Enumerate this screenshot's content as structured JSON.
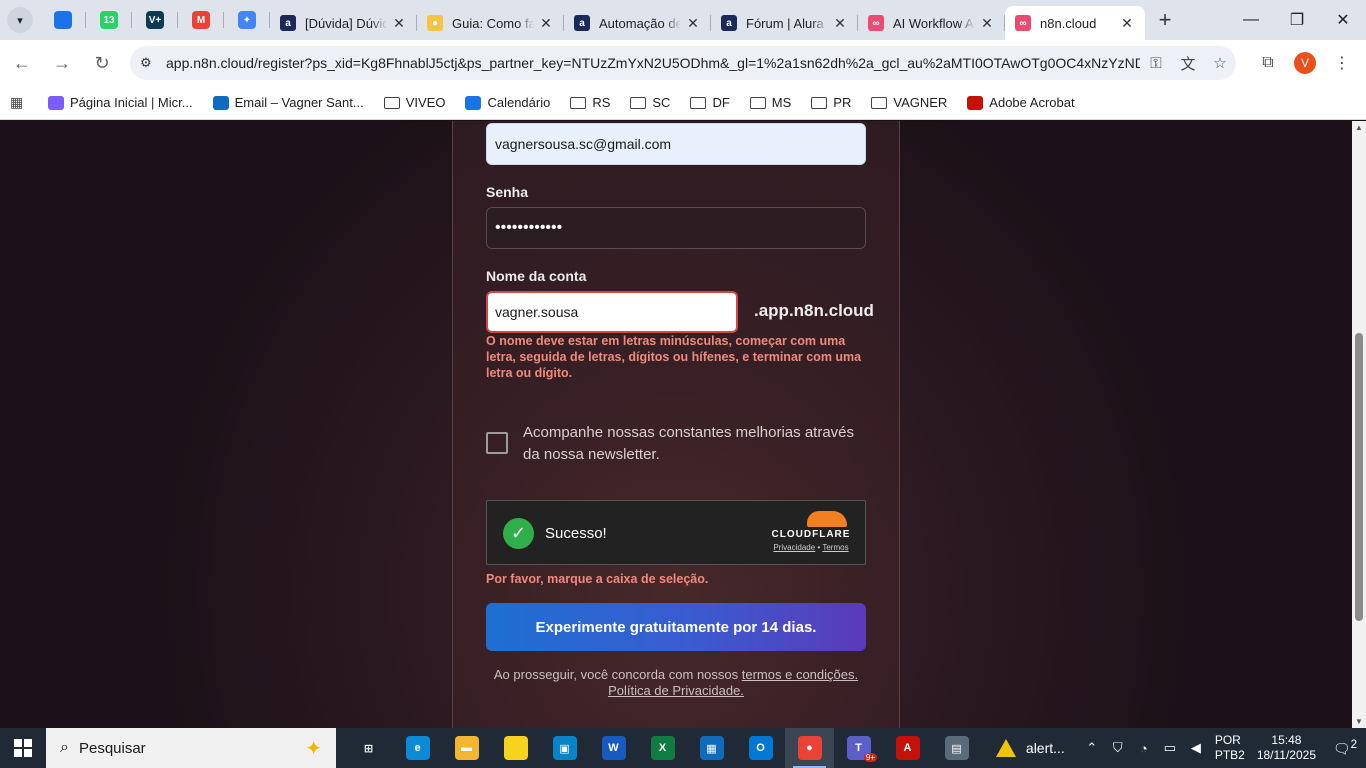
{
  "browser": {
    "pinned_tabs": [
      {
        "icon": "outlook-icon",
        "label": "",
        "color": "#1a73e8"
      },
      {
        "icon": "whatsapp-icon",
        "label": "13",
        "color": "#25d366"
      },
      {
        "icon": "vplus-icon",
        "label": "V+",
        "color": "#0b3a55"
      },
      {
        "icon": "gmail-icon",
        "label": "M",
        "color": "#ea4335"
      },
      {
        "icon": "gemini-icon",
        "label": "✦",
        "color": "#4285f4"
      }
    ],
    "tabs": [
      {
        "title": "[Dúvida] Dúvid",
        "fav_label": "a",
        "fav_color": "#1c2a5a",
        "active": false
      },
      {
        "title": "Guia: Como fa",
        "fav_label": "●",
        "fav_color": "#f6c343",
        "active": false
      },
      {
        "title": "Automação de",
        "fav_label": "a",
        "fav_color": "#1c2a5a",
        "active": false
      },
      {
        "title": "Fórum | Alura",
        "fav_label": "a",
        "fav_color": "#1c2a5a",
        "active": false
      },
      {
        "title": "AI Workflow A",
        "fav_label": "∞",
        "fav_color": "#ea4b71",
        "active": false
      },
      {
        "title": "n8n.cloud",
        "fav_label": "∞",
        "fav_color": "#ea4b71",
        "active": true
      }
    ],
    "new_tab": "+",
    "url": "app.n8n.cloud/register?ps_xid=Kg8FhnablJ5ctj&ps_partner_key=NTUzZmYxN2U5ODhm&_gl=1%2a1sn62dh%2a_gcl_au%2aMTI0OTAwOTg0OC4xNzYzND...",
    "profile_initial": "V",
    "bookmarks": [
      {
        "label": "Página Inicial | Micr...",
        "type": "link",
        "color": "#7b5cff"
      },
      {
        "label": "Email – Vagner Sant...",
        "type": "link",
        "color": "#0f6cbd"
      },
      {
        "label": "VIVEO",
        "type": "folder"
      },
      {
        "label": "Calendário",
        "type": "link",
        "color": "#1a73e8"
      },
      {
        "label": "RS",
        "type": "folder"
      },
      {
        "label": "SC",
        "type": "folder"
      },
      {
        "label": "DF",
        "type": "folder"
      },
      {
        "label": "MS",
        "type": "folder"
      },
      {
        "label": "PR",
        "type": "folder"
      },
      {
        "label": "VAGNER",
        "type": "folder"
      },
      {
        "label": "Adobe Acrobat",
        "type": "link",
        "color": "#c4120a"
      }
    ]
  },
  "form": {
    "email_value": "vagnersousa.sc@gmail.com",
    "password_label": "Senha",
    "password_value": "••••••••••••",
    "account_label": "Nome da conta",
    "account_value": "vagner.sousa",
    "account_suffix": ".app.n8n.cloud",
    "account_error": "O nome deve estar em letras minúsculas, começar com uma letra, seguida de letras, dígitos ou hífenes, e terminar com uma letra ou dígito.",
    "newsletter_label": "Acompanhe nossas constantes melhorias através da nossa newsletter.",
    "captcha_status": "Sucesso!",
    "captcha_brand": "CLOUDFLARE",
    "captcha_privacy": "Privacidade",
    "captcha_sep": "•",
    "captcha_terms": "Termos",
    "captcha_error": "Por favor, marque a caixa de seleção.",
    "submit_label": "Experimente gratuitamente por 14 dias.",
    "legal_prefix": "Ao prosseguir, você concorda com nossos",
    "legal_terms": "termos e condições.",
    "legal_privacy": "Política de Privacidade."
  },
  "taskbar": {
    "search_placeholder": "Pesquisar",
    "apps": [
      {
        "icon": "task-view-icon",
        "label": "⊞",
        "color": "#1f2a36"
      },
      {
        "icon": "edge-icon",
        "label": "e",
        "color": "#0c8ad6"
      },
      {
        "icon": "file-explorer-icon",
        "label": "▬",
        "color": "#f2b632"
      },
      {
        "icon": "sticky-notes-icon",
        "label": "",
        "color": "#f7d21e"
      },
      {
        "icon": "remote-desktop-icon",
        "label": "▣",
        "color": "#0a84c9"
      },
      {
        "icon": "word-icon",
        "label": "W",
        "color": "#185abd"
      },
      {
        "icon": "excel-icon",
        "label": "X",
        "color": "#107c41"
      },
      {
        "icon": "calendar-icon",
        "label": "▦",
        "color": "#0f6cbd"
      },
      {
        "icon": "outlook-icon",
        "label": "O",
        "color": "#0078d4"
      },
      {
        "icon": "chrome-icon",
        "label": "●",
        "color": "#ea4335",
        "active": true
      },
      {
        "icon": "teams-icon",
        "label": "T",
        "color": "#5b5fc7",
        "badge": "9+"
      },
      {
        "icon": "acrobat-icon",
        "label": "A",
        "color": "#c4120a"
      },
      {
        "icon": "calculator-icon",
        "label": "▤",
        "color": "#5a6b7c"
      }
    ],
    "alert_label": "alert...",
    "lang_line1": "POR",
    "lang_line2": "PTB2",
    "time": "15:48",
    "date": "18/11/2025",
    "notifications": "2"
  }
}
